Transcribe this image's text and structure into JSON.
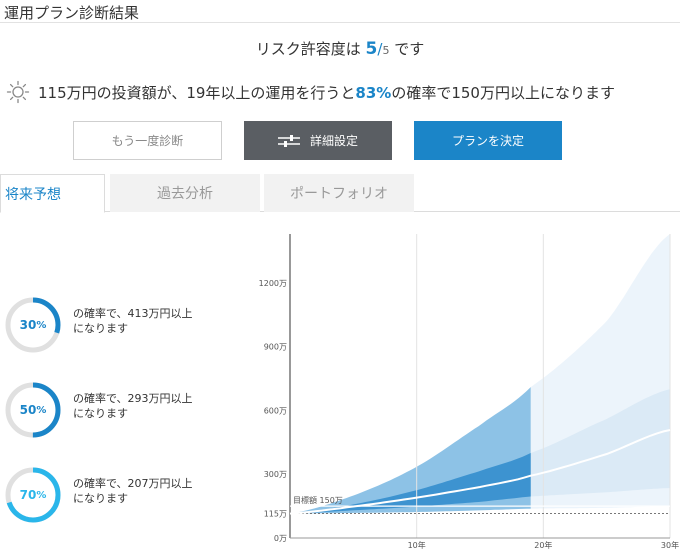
{
  "header": {
    "title": "運用プラン診断結果"
  },
  "risk": {
    "prefix": "リスク許容度は",
    "level": "5",
    "slash": "/",
    "max": "5",
    "suffix": "です"
  },
  "summary": {
    "part1": "115万円の投資額が、19年以上の運用を行うと",
    "percent": "83%",
    "part2": "の確率で150万円以上になります"
  },
  "buttons": {
    "retry": "もう一度診断",
    "detail": "詳細設定",
    "decide": "プランを決定"
  },
  "tabs": {
    "future": "将来予想",
    "past": "過去分析",
    "portfolio": "ポートフォリオ"
  },
  "probabilities": [
    {
      "value": "30",
      "unit": "%",
      "line1": "の確率で、413万円以上",
      "line2": "になります",
      "color": "#1b85c8",
      "fraction": 0.3
    },
    {
      "value": "50",
      "unit": "%",
      "line1": "の確率で、293万円以上",
      "line2": "になります",
      "color": "#1b85c8",
      "fraction": 0.5
    },
    {
      "value": "70",
      "unit": "%",
      "line1": "の確率で、207万円以上",
      "line2": "になります",
      "color": "#2ab6ea",
      "fraction": 0.7
    }
  ],
  "colors": {
    "accent": "#1b85c8",
    "dark_button": "#5a5e63",
    "light_blue": "#2ab6ea"
  },
  "chart_data": {
    "type": "area",
    "y_ticks": [
      {
        "value": 0,
        "label": "0万"
      },
      {
        "value": 115,
        "label": "115万"
      },
      {
        "value": 300,
        "label": "300万"
      },
      {
        "value": 600,
        "label": "600万"
      },
      {
        "value": 900,
        "label": "900万"
      },
      {
        "value": 1200,
        "label": "1200万"
      }
    ],
    "x_ticks": [
      {
        "value": 10,
        "label": "10年"
      },
      {
        "value": 20,
        "label": "20年"
      },
      {
        "value": 30,
        "label": "30年"
      }
    ],
    "xlim": [
      0,
      30
    ],
    "ylim": [
      0,
      1430
    ],
    "target": {
      "value": 150,
      "label": "目標額 150万"
    },
    "projection_split_year": 19,
    "bands": {
      "years": [
        0,
        5,
        10,
        15,
        19,
        25,
        30
      ],
      "outer_upper": [
        115,
        200,
        335,
        530,
        710,
        1020,
        1430
      ],
      "outer_lower": [
        115,
        118,
        122,
        130,
        138,
        142,
        150
      ],
      "inner_upper": [
        115,
        158,
        225,
        315,
        400,
        560,
        700
      ],
      "inner_lower": [
        115,
        130,
        148,
        170,
        195,
        215,
        235
      ],
      "median": [
        115,
        148,
        190,
        240,
        293,
        395,
        508
      ]
    }
  }
}
